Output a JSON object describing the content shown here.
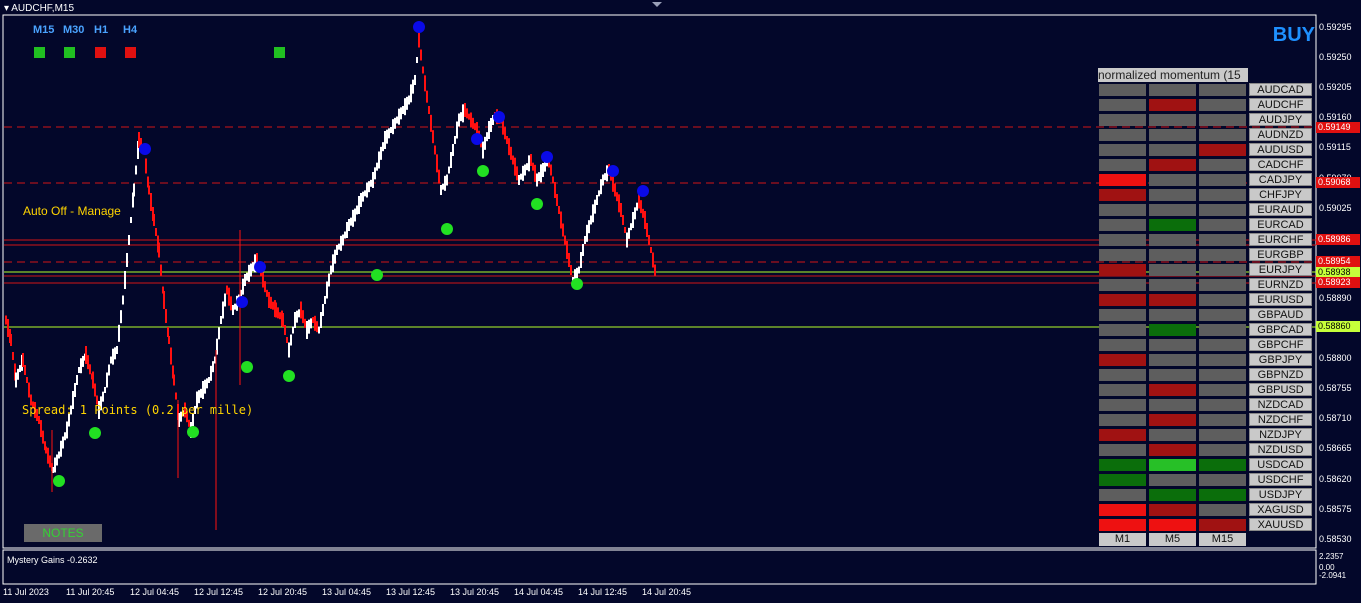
{
  "window": {
    "title": "AUDCHF,M15"
  },
  "timeframes": [
    {
      "label": "M15",
      "signal_color": "#21c021"
    },
    {
      "label": "M30",
      "signal_color": "#21c021"
    },
    {
      "label": "H1",
      "signal_color": "#e01010"
    },
    {
      "label": "H4",
      "signal_color": "#e01010"
    }
  ],
  "extra_signal_color": "#21c021",
  "buy_label": "BUY",
  "auto_text": "Auto Off - Manage",
  "spread_text": "Spread: 1 Points (0.2 per mille)",
  "notes_button": "NOTES",
  "momentum_panel": {
    "title": "normalized momentum (15",
    "symbols": [
      "AUDCAD",
      "AUDCHF",
      "AUDJPY",
      "AUDNZD",
      "AUDUSD",
      "CADCHF",
      "CADJPY",
      "CHFJPY",
      "EURAUD",
      "EURCAD",
      "EURCHF",
      "EURGBP",
      "EURJPY",
      "EURNZD",
      "EURUSD",
      "GBPAUD",
      "GBPCAD",
      "GBPCHF",
      "GBPJPY",
      "GBPNZD",
      "GBPUSD",
      "NZDCAD",
      "NZDCHF",
      "NZDJPY",
      "NZDUSD",
      "USDCAD",
      "USDCHF",
      "USDJPY",
      "XAGUSD",
      "XAUUSD"
    ],
    "columns": [
      "M1",
      "M5",
      "M15"
    ],
    "cells": [
      [
        "gray",
        "gray",
        "gray"
      ],
      [
        "gray",
        "darkred",
        "gray"
      ],
      [
        "gray",
        "gray",
        "gray"
      ],
      [
        "gray",
        "gray",
        "gray"
      ],
      [
        "gray",
        "gray",
        "darkred"
      ],
      [
        "gray",
        "darkred",
        "gray"
      ],
      [
        "red",
        "gray",
        "gray"
      ],
      [
        "darkred",
        "gray",
        "gray"
      ],
      [
        "gray",
        "gray",
        "gray"
      ],
      [
        "gray",
        "darkgreen",
        "gray"
      ],
      [
        "gray",
        "gray",
        "gray"
      ],
      [
        "gray",
        "gray",
        "gray"
      ],
      [
        "darkred",
        "gray",
        "gray"
      ],
      [
        "gray",
        "gray",
        "gray"
      ],
      [
        "darkred",
        "darkred",
        "gray"
      ],
      [
        "gray",
        "gray",
        "gray"
      ],
      [
        "gray",
        "darkgreen",
        "gray"
      ],
      [
        "gray",
        "gray",
        "gray"
      ],
      [
        "darkred",
        "gray",
        "gray"
      ],
      [
        "gray",
        "gray",
        "gray"
      ],
      [
        "gray",
        "darkred",
        "gray"
      ],
      [
        "gray",
        "gray",
        "gray"
      ],
      [
        "gray",
        "darkred",
        "gray"
      ],
      [
        "darkred",
        "gray",
        "gray"
      ],
      [
        "gray",
        "darkred",
        "gray"
      ],
      [
        "darkgreen",
        "green",
        "darkgreen"
      ],
      [
        "darkgreen",
        "gray",
        "gray"
      ],
      [
        "gray",
        "darkgreen",
        "darkgreen"
      ],
      [
        "red",
        "darkred",
        "gray"
      ],
      [
        "red",
        "red",
        "darkred"
      ]
    ],
    "colors": {
      "gray": "#5e5e5e",
      "darkred": "#a01212",
      "red": "#ee1111",
      "darkgreen": "#0b6e0b",
      "green": "#27c027"
    }
  },
  "price_axis": [
    "0.59295",
    "0.59250",
    "0.59205",
    "0.59160",
    "0.59115",
    "0.59070",
    "0.59025",
    "0.58980",
    "0.58935",
    "0.58890",
    "0.58845",
    "0.58800",
    "0.58755",
    "0.58710",
    "0.58665",
    "0.58620",
    "0.58575",
    "0.58530"
  ],
  "price_tags": [
    {
      "value": "0.59149",
      "bg": "#e01010",
      "color": "#ffffff"
    },
    {
      "value": "0.59068",
      "bg": "#e01010",
      "color": "#ffffff"
    },
    {
      "value": "0.58986",
      "bg": "#e01010",
      "color": "#ffffff"
    },
    {
      "value": "0.58954",
      "bg": "#e01010",
      "color": "#ffffff"
    },
    {
      "value": "0.58938",
      "bg": "#c6ff3a",
      "color": "#000000"
    },
    {
      "value": "0.58923",
      "bg": "#e01010",
      "color": "#ffffff"
    },
    {
      "value": "0.58860",
      "bg": "#c6ff3a",
      "color": "#000000"
    }
  ],
  "time_axis": [
    "11 Jul 2023",
    "11 Jul 20:45",
    "12 Jul 04:45",
    "12 Jul 12:45",
    "12 Jul 20:45",
    "13 Jul 04:45",
    "13 Jul 12:45",
    "13 Jul 20:45",
    "14 Jul 04:45",
    "14 Jul 12:45",
    "14 Jul 20:45"
  ],
  "subwindow": {
    "title": "Mystery Gains -0.2632",
    "axis": [
      "2.2357",
      "0.00",
      "-2.0941"
    ]
  }
}
